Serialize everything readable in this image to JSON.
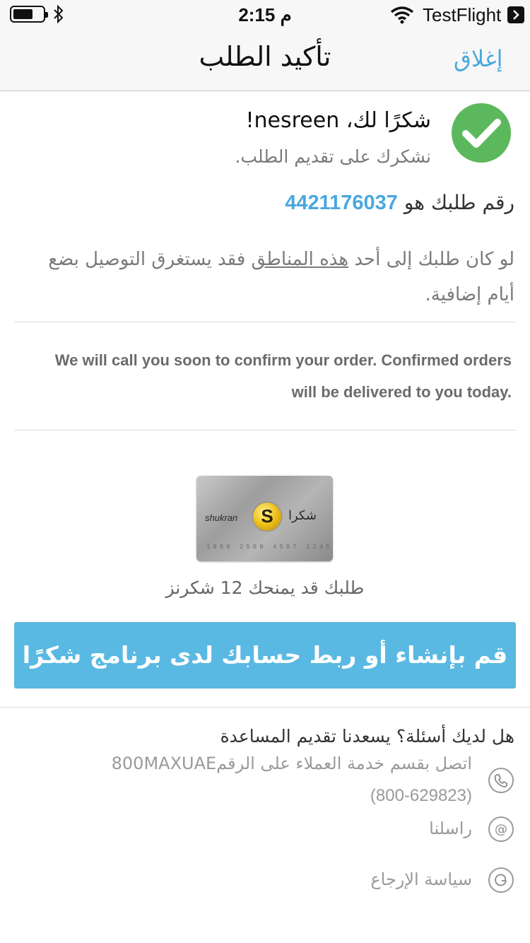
{
  "status_bar": {
    "time": "2:15 م",
    "carrier": "TestFlight"
  },
  "nav": {
    "title": "تأكيد الطلب",
    "close_label": "إغلاق"
  },
  "confirmation": {
    "title": "شكرًا لك، nesreen!",
    "subtitle": "نشكرك على تقديم الطلب.",
    "order_prefix": "رقم طلبك هو",
    "order_number": "4421176037",
    "delivery_note_before": "لو كان طلبك إلى أحد",
    "delivery_note_link": "هذه المناطق",
    "delivery_note_after": "فقد يستغرق التوصيل بضع أيام إضافية.",
    "en_note": "We will call you soon to confirm your order. Confirmed orders will be delivered to you today."
  },
  "shukran": {
    "card_brand_en": "shukran",
    "card_brand_ar": "شكرا",
    "card_letter": "S",
    "card_number": "1800 2568 4587 1245",
    "points_caption": "طلبك قد يمنحك 12 شكرنز",
    "link_button_label": "قم بإنشاء أو ربط حسابك لدى برنامج شكرًا الآن!"
  },
  "help": {
    "title": "هل لديك أسئلة؟ يسعدنا تقديم المساعدة",
    "phone_label": "اتصل بقسم خدمة العملاء على الرقم800MAXUAE",
    "phone_number": "(800-629823)",
    "email_label": "راسلنا",
    "returns_label": "سياسة الإرجاع"
  },
  "colors": {
    "accent": "#4aa8de",
    "button": "#5ab9e2",
    "success": "#5cb85c",
    "muted": "#9a9a9a"
  }
}
